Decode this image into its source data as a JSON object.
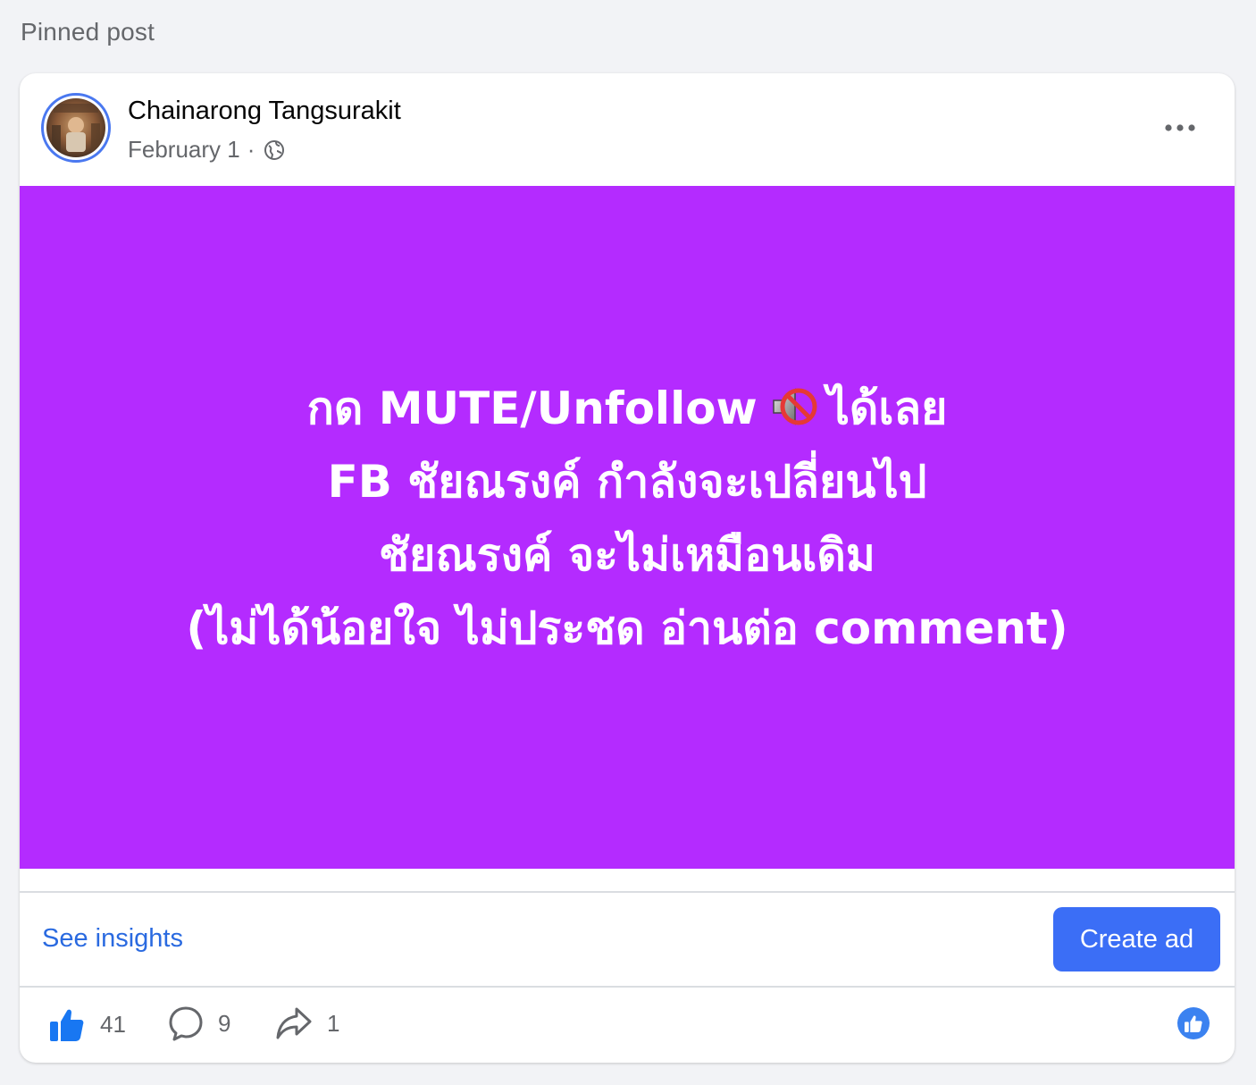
{
  "section": {
    "label": "Pinned post"
  },
  "post": {
    "author": "Chainarong Tangsurakit",
    "date": "February 1",
    "separator": "·",
    "privacy_icon": "globe-icon",
    "menu_icon": "more-horizontal-icon",
    "background_color": "#b42bff",
    "text_lines": {
      "line1_before": "กด MUTE/Unfollow",
      "line1_emoji": "muted-speaker-icon",
      "line1_after": "ได้เลย",
      "line2": "FB ชัยณรงค์ กำลังจะเปลี่ยนไป",
      "line3": "ชัยณรงค์ จะไม่เหมือนเดิม",
      "line4": "(ไม่ได้น้อยใจ ไม่ประชด อ่านต่อ comment)"
    }
  },
  "actions": {
    "insights_label": "See insights",
    "create_ad_label": "Create ad"
  },
  "stats": {
    "likes": "41",
    "comments": "9",
    "shares": "1",
    "like_icon": "thumbs-up-icon",
    "comment_icon": "comment-icon",
    "share_icon": "share-icon",
    "reaction_icon": "like-reaction-icon"
  },
  "colors": {
    "accent": "#3b6ef6",
    "link": "#2a6ae0",
    "post_bg": "#b42bff",
    "page_bg": "#f2f3f6"
  }
}
